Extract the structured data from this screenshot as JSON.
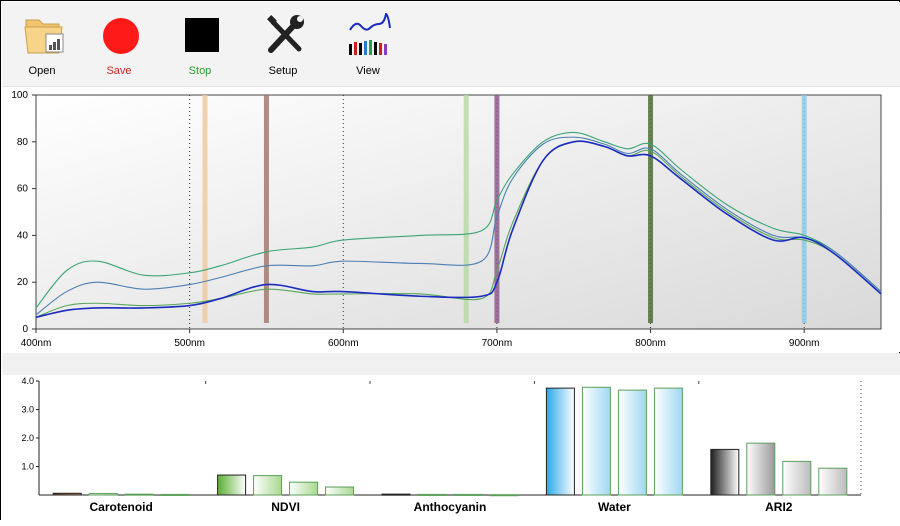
{
  "toolbar": {
    "open_label": "Open",
    "save_label": "Save",
    "stop_label": "Stop",
    "setup_label": "Setup",
    "view_label": "View"
  },
  "chart_data": [
    {
      "type": "line",
      "title": "",
      "xlabel": "",
      "ylabel": "",
      "xlim": [
        400,
        950
      ],
      "ylim": [
        0,
        100
      ],
      "x_ticks": [
        "400nm",
        "500nm",
        "600nm",
        "700nm",
        "800nm",
        "900nm"
      ],
      "y_ticks": [
        "0",
        "20",
        "40",
        "60",
        "80",
        "100"
      ],
      "band_markers": [
        {
          "x": 510,
          "color": "#f2c9a0"
        },
        {
          "x": 550,
          "color": "#a27a6c"
        },
        {
          "x": 680,
          "color": "#b9dba5"
        },
        {
          "x": 700,
          "color": "#8e5c8e"
        },
        {
          "x": 800,
          "color": "#4f6f3a"
        },
        {
          "x": 900,
          "color": "#8ccbe8"
        }
      ],
      "series": [
        {
          "color": "#3aa575",
          "x": [
            400,
            420,
            440,
            470,
            500,
            520,
            550,
            580,
            600,
            650,
            690,
            700,
            710,
            730,
            750,
            770,
            785,
            800,
            820,
            850,
            880,
            900,
            920,
            950
          ],
          "values": [
            9,
            25,
            29,
            23,
            24,
            27,
            33,
            35,
            38,
            40,
            42,
            55,
            66,
            80,
            84,
            80,
            77,
            79,
            68,
            53,
            43,
            40,
            33,
            16
          ]
        },
        {
          "color": "#4a7fb3",
          "x": [
            400,
            420,
            440,
            470,
            500,
            520,
            550,
            580,
            600,
            650,
            690,
            700,
            710,
            730,
            750,
            770,
            785,
            800,
            820,
            850,
            880,
            900,
            920,
            950
          ],
          "values": [
            6,
            16,
            20,
            17,
            19,
            22,
            27,
            27,
            29,
            28,
            29,
            48,
            64,
            79,
            82,
            79,
            75,
            77,
            66,
            51,
            40,
            39,
            33,
            16
          ]
        },
        {
          "color": "#59a65a",
          "x": [
            400,
            420,
            440,
            470,
            500,
            520,
            550,
            580,
            600,
            650,
            690,
            700,
            710,
            730,
            750,
            770,
            785,
            800,
            820,
            850,
            880,
            900,
            920,
            950
          ],
          "values": [
            5,
            10,
            11,
            10,
            11,
            13,
            17,
            15,
            15,
            15,
            13,
            25,
            45,
            72,
            80,
            78,
            74,
            76,
            65,
            50,
            39,
            38,
            32,
            15
          ]
        },
        {
          "color": "#1b2bc0",
          "x": [
            400,
            420,
            440,
            470,
            500,
            520,
            550,
            580,
            600,
            650,
            690,
            700,
            710,
            730,
            750,
            770,
            785,
            800,
            820,
            850,
            880,
            900,
            920,
            950
          ],
          "values": [
            5,
            8,
            9,
            9,
            10,
            13,
            19,
            16,
            16,
            14,
            14,
            20,
            42,
            72,
            80,
            78,
            74,
            74,
            64,
            49,
            38,
            39,
            32,
            15
          ]
        }
      ]
    },
    {
      "type": "bar",
      "title": "",
      "categories": [
        "Carotenoid",
        "NDVI",
        "Anthocyanin",
        "Water",
        "ARI2"
      ],
      "ylim": [
        0,
        4
      ],
      "y_ticks": [
        "4.0",
        "3.0",
        "2.0",
        "1.0"
      ],
      "series": [
        {
          "values": [
            0.06,
            0.7,
            0.03,
            3.75,
            1.6
          ]
        },
        {
          "values": [
            0.05,
            0.68,
            0.02,
            3.78,
            1.82
          ]
        },
        {
          "values": [
            0.03,
            0.45,
            0.02,
            3.68,
            1.18
          ]
        },
        {
          "values": [
            0.02,
            0.28,
            0.01,
            3.75,
            0.94
          ]
        }
      ]
    }
  ]
}
